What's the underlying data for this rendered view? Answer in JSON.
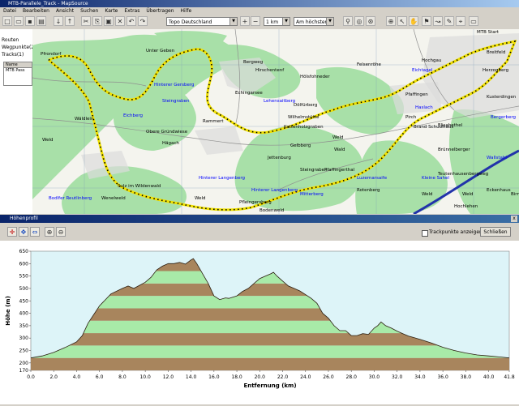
{
  "window": {
    "title": "MTB-Parallele_Track - MapSource"
  },
  "menu": [
    "Datei",
    "Bearbeiten",
    "Ansicht",
    "Suchen",
    "Karte",
    "Extras",
    "Übertragen",
    "Hilfe"
  ],
  "toolbar": {
    "map_product": "Topo Deutschland",
    "zoom_level": "1 km",
    "detail": "Am höchsten"
  },
  "left_panel": {
    "tab_routes": "Routen",
    "tab_waypoints": "Wegpunkte(2)",
    "tab_tracks": "Tracks(1)",
    "col_name": "Name",
    "track_name": "MTB Pass"
  },
  "map": {
    "labels": [
      {
        "t": "Pfrondorf",
        "c": "#000"
      },
      {
        "t": "Unter Geben",
        "c": "#000"
      },
      {
        "t": "Hinterer Gersberg",
        "c": "#00f"
      },
      {
        "t": "Steingraben",
        "c": "#00f"
      },
      {
        "t": "Eichberg",
        "c": "#00f"
      },
      {
        "t": "Wäldlein",
        "c": "#000"
      },
      {
        "t": "Weld",
        "c": "#000"
      },
      {
        "t": "Hägach",
        "c": "#000"
      },
      {
        "t": "Obere Gründwiese",
        "c": "#000"
      },
      {
        "t": "Rammert",
        "c": "#000"
      },
      {
        "t": "Echingarsee",
        "c": "#000"
      },
      {
        "t": "Hirschentenf",
        "c": "#000"
      },
      {
        "t": "Lehensaitberg",
        "c": "#00f"
      },
      {
        "t": "Dölfürberg",
        "c": "#000"
      },
      {
        "t": "Wilhelmstütte",
        "c": "#000"
      },
      {
        "t": "Kettenholzgraben",
        "c": "#000"
      },
      {
        "t": "Gelbberg",
        "c": "#000"
      },
      {
        "t": "Weld",
        "c": "#000"
      },
      {
        "t": "Steingraben",
        "c": "#000"
      },
      {
        "t": "Pfaffingerthal",
        "c": "#000"
      },
      {
        "t": "Hinterer Langenberg",
        "c": "#00f"
      },
      {
        "t": "Sulz im Wildenwald",
        "c": "#000"
      },
      {
        "t": "Wenelweld",
        "c": "#000"
      },
      {
        "t": "Bodlfer Reutlinberg",
        "c": "#00f"
      },
      {
        "t": "Weld",
        "c": "#000"
      },
      {
        "t": "Pfleingersberg",
        "c": "#000"
      },
      {
        "t": "Bodenweld",
        "c": "#000"
      },
      {
        "t": "Rotenberg",
        "c": "#000"
      },
      {
        "t": "Weld",
        "c": "#000"
      },
      {
        "t": "Eichtagel",
        "c": "#00f"
      },
      {
        "t": "Pfaffingen",
        "c": "#000"
      },
      {
        "t": "Haslach",
        "c": "#00f"
      },
      {
        "t": "Elisabethel",
        "c": "#000"
      },
      {
        "t": "Brünnelberger",
        "c": "#000"
      },
      {
        "t": "Luzernarsaife",
        "c": "#00f"
      },
      {
        "t": "Kleine Sahel",
        "c": "#00f"
      },
      {
        "t": "Teutenhausenbergweg",
        "c": "#000"
      },
      {
        "t": "Weld",
        "c": "#000"
      },
      {
        "t": "Hochlehen",
        "c": "#000"
      },
      {
        "t": "Hinterer Langenberg",
        "c": "#00f"
      },
      {
        "t": "Mitterberg",
        "c": "#00f"
      },
      {
        "t": "Hölsfohneder",
        "c": "#000"
      },
      {
        "t": "MTB Start",
        "c": "#000"
      },
      {
        "t": "Herzogberg",
        "c": "#000"
      },
      {
        "t": "Wallstahl",
        "c": "#00f"
      },
      {
        "t": "Birn",
        "c": "#000"
      },
      {
        "t": "Bergerberg",
        "c": "#00f"
      },
      {
        "t": "Kusterdingen",
        "c": "#000"
      },
      {
        "t": "Wald",
        "c": "#000"
      },
      {
        "t": "Pirch",
        "c": "#000"
      },
      {
        "t": "Brand Schulzhaus",
        "c": "#000"
      },
      {
        "t": "Bergweg",
        "c": "#000"
      },
      {
        "t": "Jettenburg",
        "c": "#000"
      },
      {
        "t": "Eckenhaus",
        "c": "#000"
      },
      {
        "t": "Hochgau",
        "c": "#000"
      },
      {
        "t": "Felsenröhe",
        "c": "#000"
      },
      {
        "t": "Breitfeld",
        "c": "#000"
      }
    ]
  },
  "profile": {
    "window_title": "Höhenprofil",
    "checkbox_label": "Trackpunkte anzeigen",
    "close_label": "Schließen",
    "close_glyph": "x"
  },
  "chart_data": {
    "type": "area",
    "xlabel": "Entfernung (km)",
    "ylabel": "Höhe (m)",
    "xlim": [
      0,
      41.8
    ],
    "ylim": [
      170,
      650
    ],
    "x_ticks": [
      "0.0",
      "2.0",
      "4.0",
      "6.0",
      "8.0",
      "10.0",
      "12.0",
      "14.0",
      "16.0",
      "18.0",
      "20.0",
      "22.0",
      "24.0",
      "26.0",
      "28.0",
      "30.0",
      "32.0",
      "34.0",
      "36.0",
      "38.0",
      "40.0",
      "41.8"
    ],
    "y_ticks": [
      "170",
      "200",
      "250",
      "300",
      "350",
      "400",
      "450",
      "500",
      "550",
      "600",
      "650"
    ],
    "fill_colors": [
      "#a8855d",
      "#a8eaa8"
    ],
    "band_height_m": 50,
    "series": [
      {
        "x": [
          0,
          1,
          2,
          3,
          4,
          4.5,
          5,
          6,
          7,
          8,
          8.5,
          9,
          10,
          10.5,
          11,
          11.5,
          12,
          12.5,
          13,
          13.5,
          14,
          14.2,
          14.5,
          15,
          15.5,
          16,
          16.5,
          17,
          17.3,
          18,
          18.5,
          19,
          19.5,
          20,
          20.5,
          21,
          21.2,
          21.5,
          22,
          22.5,
          23,
          23.5,
          24,
          24.5,
          25,
          25.5,
          26,
          26.5,
          27,
          27.5,
          28,
          28.5,
          29,
          29.5,
          30,
          30.3,
          30.6,
          31,
          31.5,
          32,
          32.5,
          33,
          34,
          35,
          36,
          37,
          38,
          39,
          40,
          41,
          41.8
        ],
        "y": [
          220,
          228,
          242,
          262,
          285,
          310,
          360,
          430,
          478,
          500,
          510,
          500,
          525,
          545,
          575,
          590,
          600,
          600,
          605,
          598,
          615,
          620,
          600,
          560,
          520,
          470,
          455,
          462,
          460,
          470,
          488,
          500,
          520,
          540,
          550,
          560,
          565,
          550,
          530,
          510,
          500,
          490,
          475,
          460,
          440,
          400,
          380,
          350,
          330,
          330,
          310,
          310,
          318,
          315,
          340,
          350,
          365,
          350,
          340,
          328,
          318,
          308,
          295,
          280,
          263,
          250,
          240,
          232,
          228,
          224,
          220
        ]
      }
    ]
  }
}
